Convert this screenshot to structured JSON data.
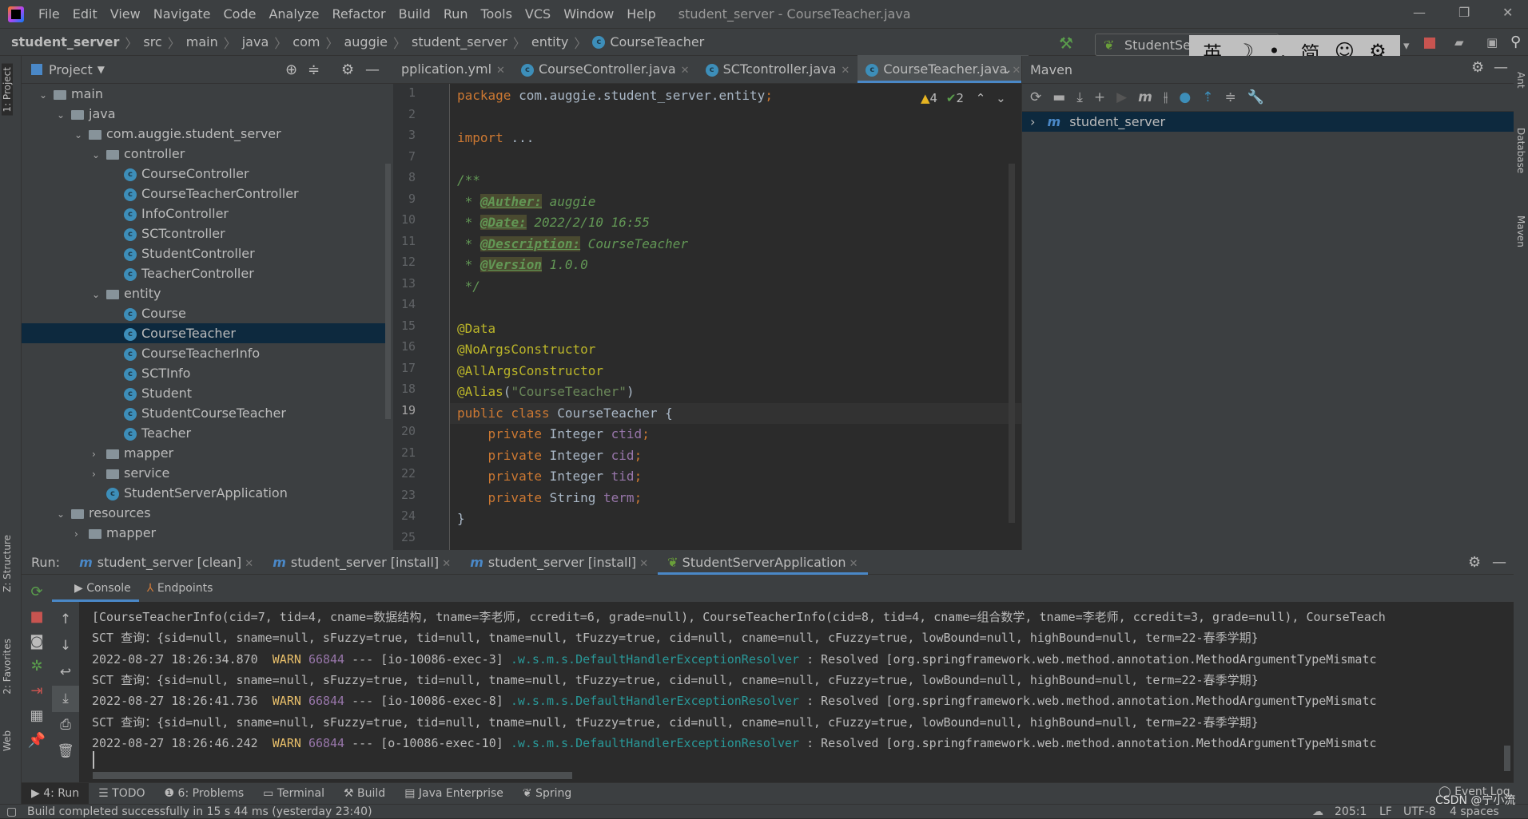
{
  "menu": [
    "File",
    "Edit",
    "View",
    "Navigate",
    "Code",
    "Analyze",
    "Refactor",
    "Build",
    "Run",
    "Tools",
    "VCS",
    "Window",
    "Help"
  ],
  "window_title": "student_server - CourseTeacher.java",
  "breadcrumbs": [
    "student_server",
    "src",
    "main",
    "java",
    "com",
    "auggie",
    "student_server",
    "entity",
    "CourseTeacher"
  ],
  "run_config": "StudentServerApplication",
  "ime": [
    "英",
    "☽",
    "•,",
    "简",
    "☺",
    "⚙"
  ],
  "left_strip": [
    "1: Project",
    "Z: Structure",
    "2: Favorites",
    "Web"
  ],
  "right_strip": [
    "Ant",
    "Database",
    "Maven"
  ],
  "project": {
    "title": "Project",
    "tree": [
      {
        "label": "main",
        "depth": 0,
        "type": "folder",
        "open": true
      },
      {
        "label": "java",
        "depth": 1,
        "type": "folder",
        "open": true
      },
      {
        "label": "com.auggie.student_server",
        "depth": 2,
        "type": "folder",
        "open": true
      },
      {
        "label": "controller",
        "depth": 3,
        "type": "folder",
        "open": true
      },
      {
        "label": "CourseController",
        "depth": 4,
        "type": "class"
      },
      {
        "label": "CourseTeacherController",
        "depth": 4,
        "type": "class"
      },
      {
        "label": "InfoController",
        "depth": 4,
        "type": "class"
      },
      {
        "label": "SCTcontroller",
        "depth": 4,
        "type": "class"
      },
      {
        "label": "StudentController",
        "depth": 4,
        "type": "class"
      },
      {
        "label": "TeacherController",
        "depth": 4,
        "type": "class"
      },
      {
        "label": "entity",
        "depth": 3,
        "type": "folder",
        "open": true
      },
      {
        "label": "Course",
        "depth": 4,
        "type": "class"
      },
      {
        "label": "CourseTeacher",
        "depth": 4,
        "type": "class",
        "selected": true
      },
      {
        "label": "CourseTeacherInfo",
        "depth": 4,
        "type": "class"
      },
      {
        "label": "SCTInfo",
        "depth": 4,
        "type": "class"
      },
      {
        "label": "Student",
        "depth": 4,
        "type": "class"
      },
      {
        "label": "StudentCourseTeacher",
        "depth": 4,
        "type": "class"
      },
      {
        "label": "Teacher",
        "depth": 4,
        "type": "class"
      },
      {
        "label": "mapper",
        "depth": 3,
        "type": "folder",
        "open": false
      },
      {
        "label": "service",
        "depth": 3,
        "type": "folder",
        "open": false
      },
      {
        "label": "StudentServerApplication",
        "depth": 3,
        "type": "app"
      },
      {
        "label": "resources",
        "depth": 1,
        "type": "folder",
        "open": true
      },
      {
        "label": "mapper",
        "depth": 2,
        "type": "folder",
        "open": false
      }
    ]
  },
  "editor": {
    "tabs": [
      {
        "label": "pplication.yml"
      },
      {
        "label": "CourseController.java",
        "c": true
      },
      {
        "label": "SCTcontroller.java",
        "c": true
      },
      {
        "label": "CourseTeacher.java",
        "c": true,
        "active": true
      }
    ],
    "warnings": "4",
    "ok": "2",
    "lines": [
      {
        "n": "1",
        "t": [
          [
            "package ",
            "kw"
          ],
          [
            "com.auggie.student_server.entity",
            "pl"
          ],
          [
            ";",
            "kw"
          ]
        ]
      },
      {
        "n": "2",
        "t": []
      },
      {
        "n": "3",
        "t": [
          [
            "import ",
            "kw"
          ],
          [
            "...",
            "pl"
          ]
        ]
      },
      {
        "n": "7",
        "t": []
      },
      {
        "n": "8",
        "t": [
          [
            "/**",
            "cm"
          ]
        ]
      },
      {
        "n": "9",
        "t": [
          [
            " * ",
            "cm"
          ],
          [
            "@Auther:",
            "tag"
          ],
          [
            " auggie",
            "cm"
          ]
        ]
      },
      {
        "n": "10",
        "t": [
          [
            " * ",
            "cm"
          ],
          [
            "@Date:",
            "tag"
          ],
          [
            " 2022/2/10 16:55",
            "cm"
          ]
        ]
      },
      {
        "n": "11",
        "t": [
          [
            " * ",
            "cm"
          ],
          [
            "@Description:",
            "tag"
          ],
          [
            " CourseTeacher",
            "cm"
          ]
        ]
      },
      {
        "n": "12",
        "t": [
          [
            " * ",
            "cm"
          ],
          [
            "@Version",
            "tag"
          ],
          [
            " 1.0.0",
            "cm"
          ]
        ]
      },
      {
        "n": "13",
        "t": [
          [
            " */",
            "cm"
          ]
        ]
      },
      {
        "n": "14",
        "t": []
      },
      {
        "n": "15",
        "t": [
          [
            "@Data",
            "ann"
          ]
        ]
      },
      {
        "n": "16",
        "t": [
          [
            "@NoArgsConstructor",
            "ann"
          ]
        ]
      },
      {
        "n": "17",
        "t": [
          [
            "@AllArgsConstructor",
            "ann"
          ]
        ]
      },
      {
        "n": "18",
        "t": [
          [
            "@Alias",
            "ann"
          ],
          [
            "(",
            "pl"
          ],
          [
            "\"CourseTeacher\"",
            "str"
          ],
          [
            ")",
            "pl"
          ]
        ]
      },
      {
        "n": "19",
        "t": [
          [
            "public class ",
            "kw"
          ],
          [
            "CourseTeacher ",
            "pl"
          ],
          [
            "{",
            "pl"
          ]
        ],
        "current": true
      },
      {
        "n": "20",
        "t": [
          [
            "    private ",
            "kw"
          ],
          [
            "Integer ",
            "pl"
          ],
          [
            "ctid",
            "fld"
          ],
          [
            ";",
            "kw"
          ]
        ]
      },
      {
        "n": "21",
        "t": [
          [
            "    private ",
            "kw"
          ],
          [
            "Integer ",
            "pl"
          ],
          [
            "cid",
            "fld"
          ],
          [
            ";",
            "kw"
          ]
        ]
      },
      {
        "n": "22",
        "t": [
          [
            "    private ",
            "kw"
          ],
          [
            "Integer ",
            "pl"
          ],
          [
            "tid",
            "fld"
          ],
          [
            ";",
            "kw"
          ]
        ]
      },
      {
        "n": "23",
        "t": [
          [
            "    private ",
            "kw"
          ],
          [
            "String ",
            "pl"
          ],
          [
            "term",
            "fld"
          ],
          [
            ";",
            "kw"
          ]
        ]
      },
      {
        "n": "24",
        "t": [
          [
            "}",
            "pl"
          ]
        ]
      },
      {
        "n": "25",
        "t": []
      }
    ]
  },
  "maven": {
    "title": "Maven",
    "project": "student_server"
  },
  "run": {
    "label": "Run:",
    "tabs": [
      {
        "label": "student_server [clean]",
        "m": true
      },
      {
        "label": "student_server [install]",
        "m": true
      },
      {
        "label": "student_server [install]",
        "m": true
      },
      {
        "label": "StudentServerApplication",
        "active": true
      }
    ],
    "console_tab": "Console",
    "endpoints_tab": "Endpoints",
    "lines": [
      [
        [
          "[CourseTeacherInfo(cid=7, tid=4, cname=数据结构, tname=李老师, ccredit=6, grade=null), CourseTeacherInfo(cid=8, tid=4, cname=组合数学, tname=李老师, ccredit=3, grade=null), CourseTeach",
          ""
        ]
      ],
      [
        [
          "SCT 查询：{sid=null, sname=null, sFuzzy=true, tid=null, tname=null, tFuzzy=true, cid=null, cname=null, cFuzzy=true, lowBound=null, highBound=null, term=22-春季学期}",
          ""
        ]
      ],
      [
        [
          "2022-08-27 18:26:34.870  ",
          ""
        ],
        [
          "WARN ",
          "warn"
        ],
        [
          "66844",
          "pid"
        ],
        [
          " --- [io-10086-exec-3] ",
          ""
        ],
        [
          ".w.s.m.s.DefaultHandlerExceptionResolver",
          "logger"
        ],
        [
          " : Resolved [org.springframework.web.method.annotation.MethodArgumentTypeMismatc",
          ""
        ]
      ],
      [
        [
          "SCT 查询：{sid=null, sname=null, sFuzzy=true, tid=null, tname=null, tFuzzy=true, cid=null, cname=null, cFuzzy=true, lowBound=null, highBound=null, term=22-春季学期}",
          ""
        ]
      ],
      [
        [
          "2022-08-27 18:26:41.736  ",
          ""
        ],
        [
          "WARN ",
          "warn"
        ],
        [
          "66844",
          "pid"
        ],
        [
          " --- [io-10086-exec-8] ",
          ""
        ],
        [
          ".w.s.m.s.DefaultHandlerExceptionResolver",
          "logger"
        ],
        [
          " : Resolved [org.springframework.web.method.annotation.MethodArgumentTypeMismatc",
          ""
        ]
      ],
      [
        [
          "SCT 查询：{sid=null, sname=null, sFuzzy=true, tid=null, tname=null, tFuzzy=true, cid=null, cname=null, cFuzzy=true, lowBound=null, highBound=null, term=22-春季学期}",
          ""
        ]
      ],
      [
        [
          "2022-08-27 18:26:46.242  ",
          ""
        ],
        [
          "WARN ",
          "warn"
        ],
        [
          "66844",
          "pid"
        ],
        [
          " --- [o-10086-exec-10] ",
          ""
        ],
        [
          ".w.s.m.s.DefaultHandlerExceptionResolver",
          "logger"
        ],
        [
          " : Resolved [org.springframework.web.method.annotation.MethodArgumentTypeMismatc",
          ""
        ]
      ]
    ]
  },
  "bottom_tabs": [
    "4: Run",
    "TODO",
    "6: Problems",
    "Terminal",
    "Build",
    "Java Enterprise",
    "Spring"
  ],
  "event_log": "Event Log",
  "status": {
    "message": "Build completed successfully in 15 s 44 ms (yesterday 23:40)",
    "position": "205:1",
    "line_sep": "LF",
    "encoding": "UTF-8",
    "indent": "4 spaces",
    "watermark": "CSDN @宁小流"
  }
}
